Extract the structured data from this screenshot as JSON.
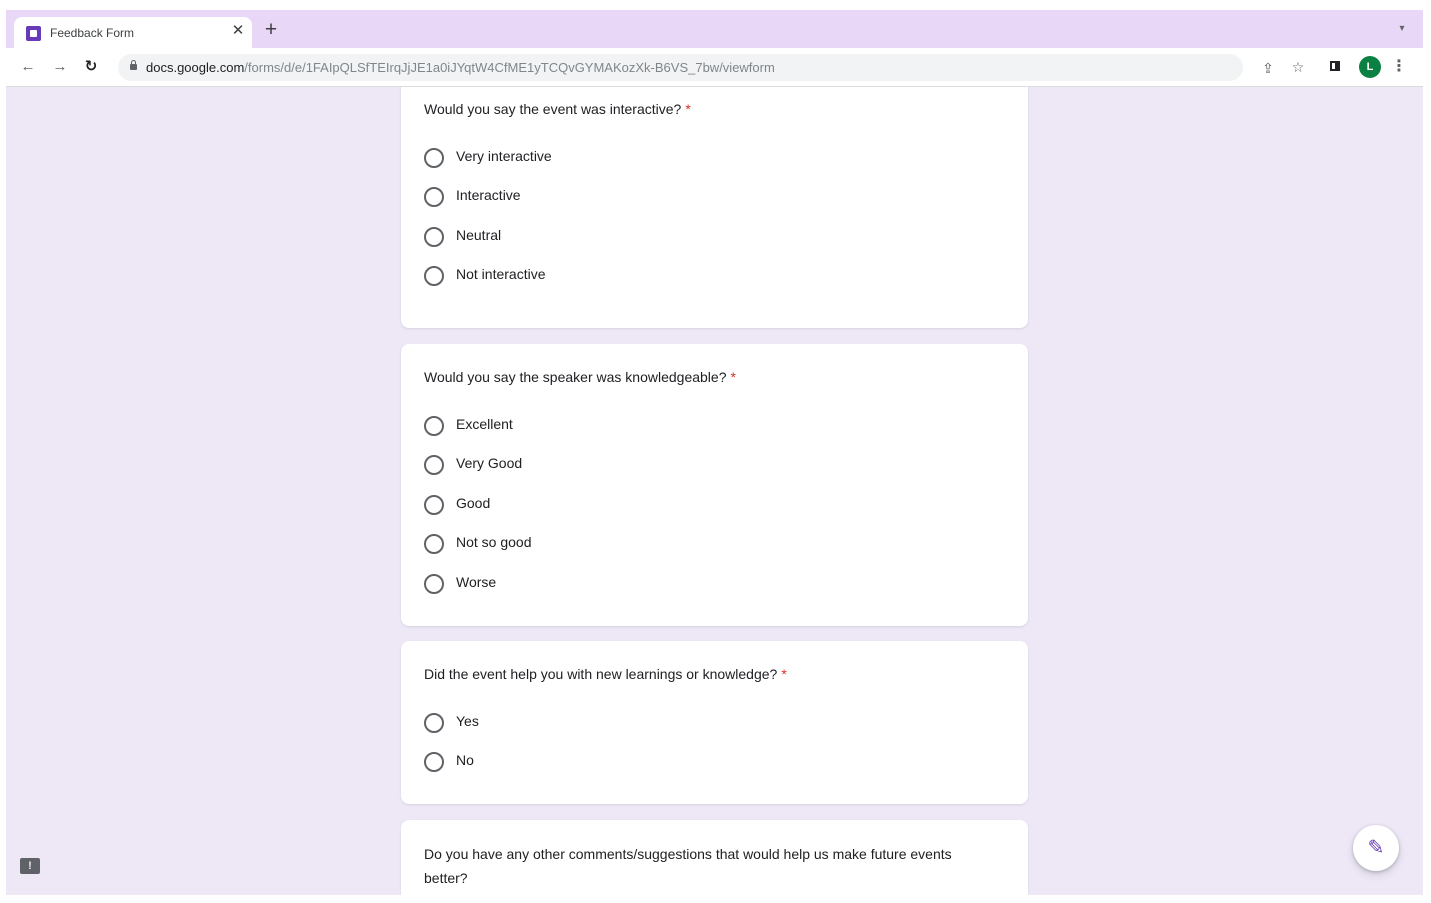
{
  "browser": {
    "tab_title": "Feedback Form",
    "tab_close": "✕",
    "new_tab": "+",
    "url_host": "docs.google.com",
    "url_path": "/forms/d/e/1FAIpQLSfTEIrqJjJE1a0iJYqtW4CfME1yTCQvGYMAKozXk-B6VS_7bw/viewform",
    "avatar_letter": "L"
  },
  "form": {
    "required_marker": "*",
    "questions": [
      {
        "title": "Would you say the event was interactive?",
        "required": true,
        "options": [
          "Very interactive",
          "Interactive",
          "Neutral",
          "Not interactive"
        ]
      },
      {
        "title": "Would you say the speaker was knowledgeable?",
        "required": true,
        "options": [
          "Excellent",
          "Very Good",
          "Good",
          "Not so good",
          "Worse"
        ]
      },
      {
        "title": "Did the event help you with new learnings or knowledge?",
        "required": true,
        "options": [
          "Yes",
          "No"
        ]
      },
      {
        "title": "Do you have any other comments/suggestions that would help us make future events better?",
        "required": false,
        "options": []
      }
    ]
  },
  "icons": {
    "back": "arrow-left",
    "forward": "arrow-right",
    "reload": "reload",
    "lock": "lock",
    "share": "share",
    "bookmark": "star",
    "side_panel": "side-panel",
    "menu": "kebab",
    "edit": "pencil",
    "report": "feedback"
  },
  "colors": {
    "page_background": "#ede7f6",
    "accent": "#673ab7",
    "required": "#d93025",
    "tab_strip": "#e8d7f6"
  }
}
